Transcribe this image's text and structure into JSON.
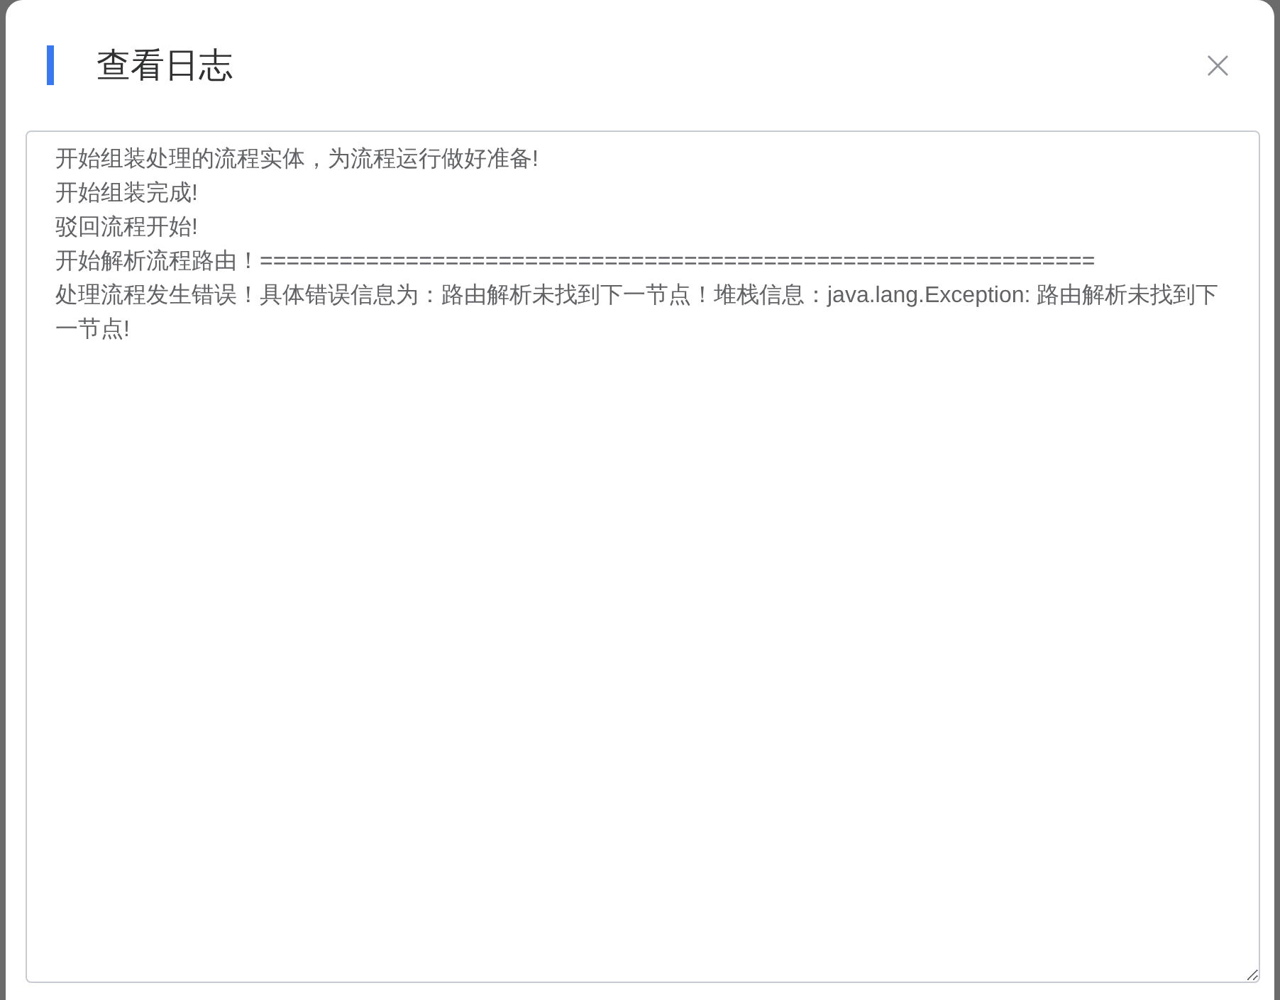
{
  "dialog": {
    "title": "查看日志",
    "close_label": "×"
  },
  "log": {
    "lines": [
      "开始组装处理的流程实体，为流程运行做好准备!",
      "开始组装完成!",
      "驳回流程开始!",
      "开始解析流程路由！===============================================================",
      "处理流程发生错误！具体错误信息为：路由解析未找到下一节点！堆栈信息：java.lang.Exception: 路由解析未找到下一节点!"
    ]
  }
}
